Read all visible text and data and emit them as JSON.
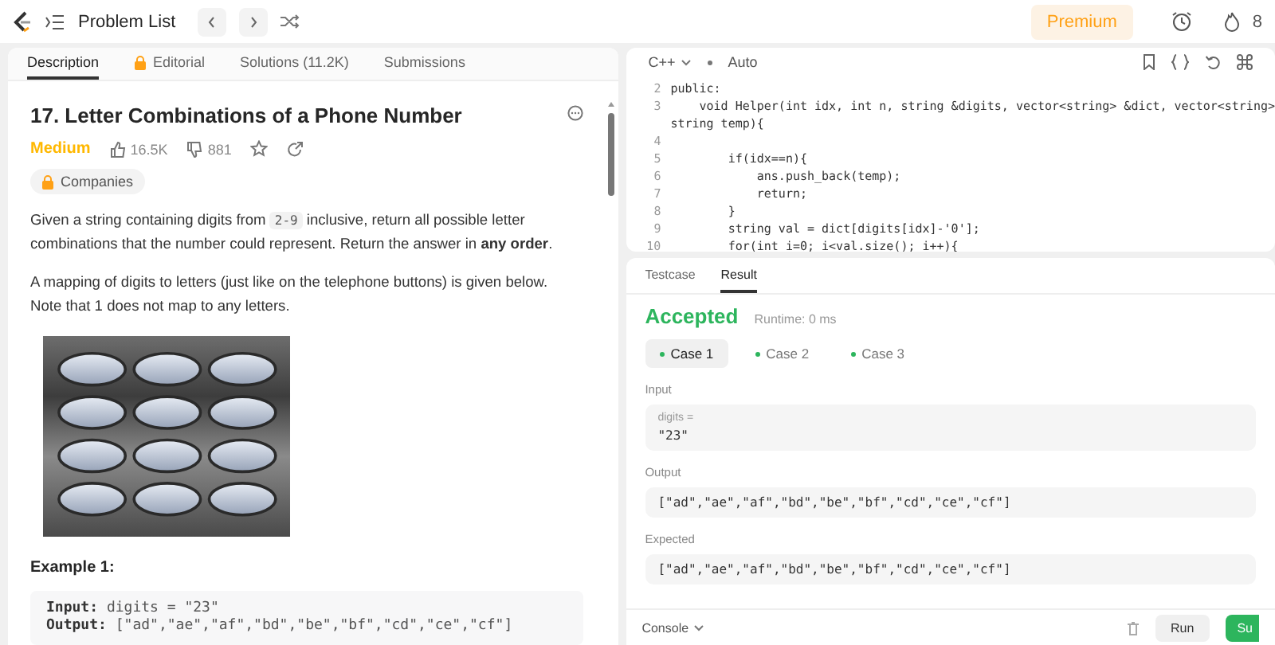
{
  "topbar": {
    "title": "Problem List",
    "premium": "Premium",
    "streak": "8"
  },
  "left_tabs": [
    {
      "label": "Description",
      "selected": true,
      "locked": false
    },
    {
      "label": "Editorial",
      "selected": false,
      "locked": true
    },
    {
      "label": "Solutions (11.2K)",
      "selected": false,
      "locked": false
    },
    {
      "label": "Submissions",
      "selected": false,
      "locked": false
    }
  ],
  "problem": {
    "title": "17. Letter Combinations of a Phone Number",
    "difficulty": "Medium",
    "likes": "16.5K",
    "dislikes": "881",
    "companies": "Companies",
    "paragraphs": [
      [
        {
          "kind": "text",
          "text": "Given a string containing digits from "
        },
        {
          "kind": "code",
          "text": "2-9"
        },
        {
          "kind": "text",
          "text": " inclusive, return all possible letter combinations that the number could represent. Return the answer in **any order**."
        }
      ],
      [
        {
          "kind": "text",
          "text": "A mapping of digits to letters (just like on the telephone buttons) is given below. Note that 1 does not map to any letters."
        }
      ]
    ],
    "example_title": "Example 1:",
    "example_lines": [
      {
        "label": "Input:",
        "value": "digits = \"23\""
      },
      {
        "label": "Output:",
        "value": "[\"ad\",\"ae\",\"af\",\"bd\",\"be\",\"bf\",\"cd\",\"ce\",\"cf\"]"
      }
    ]
  },
  "editor": {
    "language": "C++",
    "mode": "Auto",
    "lines": [
      {
        "number": "2",
        "text": "public:"
      },
      {
        "number": "3",
        "text": "    void Helper(int idx, int n, string &digits, vector<string> &dict, vector<string>"
      },
      {
        "text": "string temp){"
      },
      {
        "number": "4"
      },
      {
        "number": "5",
        "text": "        if(idx==n){"
      },
      {
        "number": "6",
        "text": "            ans.push_back(temp);"
      },
      {
        "number": "7",
        "text": "            return;"
      },
      {
        "number": "8",
        "text": "        }"
      },
      {
        "number": "9",
        "text": "        string val = dict[digits[idx]-'0'];"
      },
      {
        "number": "10",
        "text": "        for(int i=0; i<val.size(); i++){"
      }
    ]
  },
  "result_tabs": [
    {
      "label": "Testcase",
      "selected": false
    },
    {
      "label": "Result",
      "selected": true
    }
  ],
  "result": {
    "status": "Accepted",
    "runtime": "Runtime: 0 ms",
    "cases": [
      {
        "label": "Case 1",
        "selected": true
      },
      {
        "label": "Case 2",
        "selected": false
      },
      {
        "label": "Case 3",
        "selected": false
      }
    ],
    "input_label": "Input",
    "input_name": "digits =",
    "input_value": "\"23\"",
    "output_label": "Output",
    "output_value": "[\"ad\",\"ae\",\"af\",\"bd\",\"be\",\"bf\",\"cd\",\"ce\",\"cf\"]",
    "expected_label": "Expected",
    "expected_value": "[\"ad\",\"ae\",\"af\",\"bd\",\"be\",\"bf\",\"cd\",\"ce\",\"cf\"]"
  },
  "footer": {
    "console": "Console",
    "run": "Run",
    "submit": "Su"
  }
}
